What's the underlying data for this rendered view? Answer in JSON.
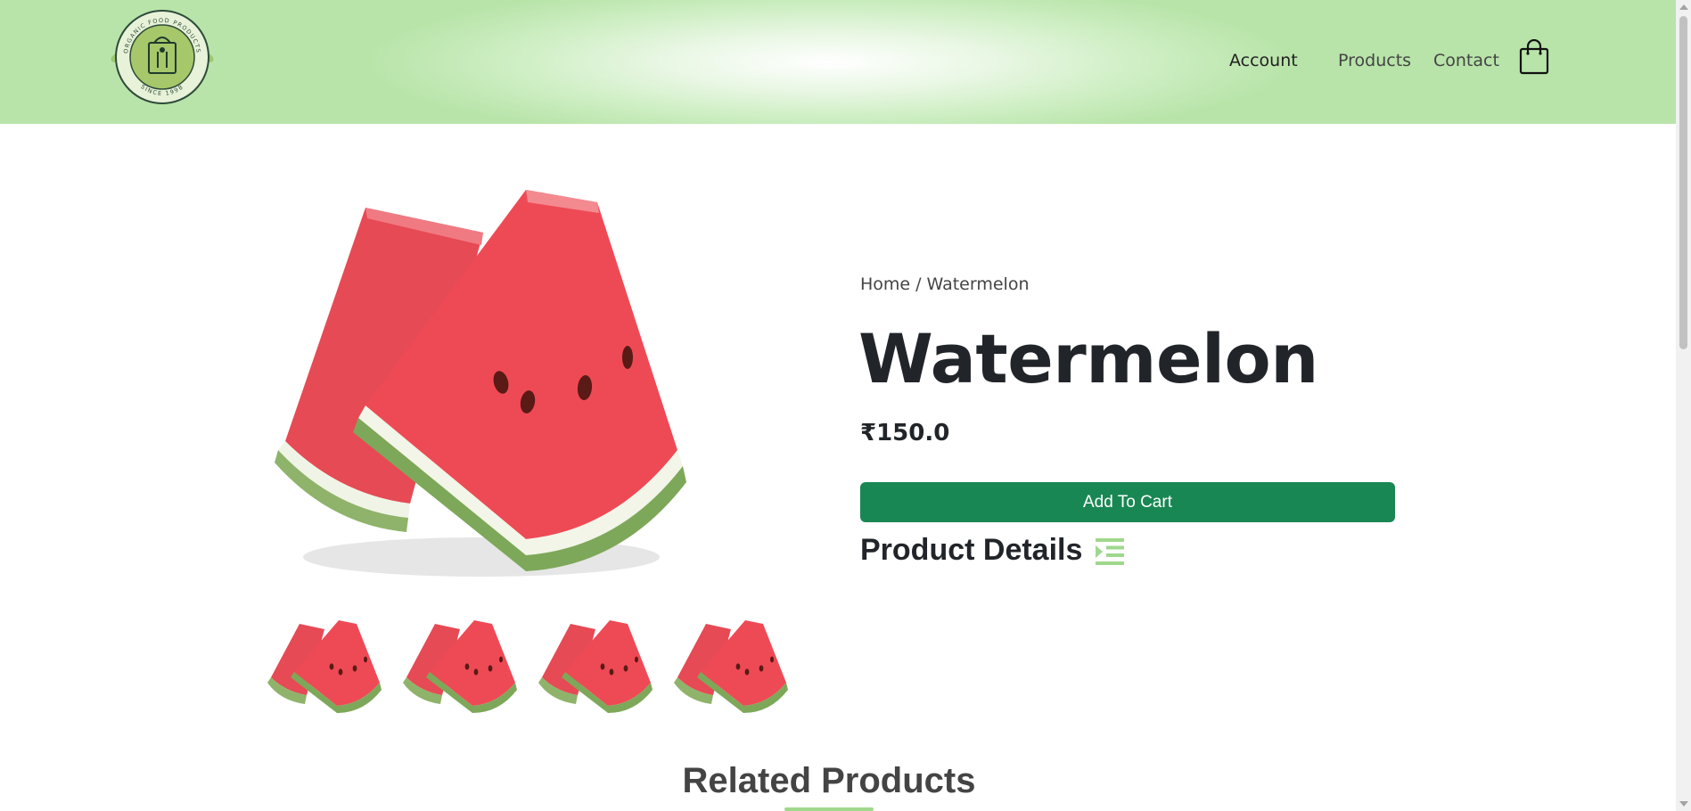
{
  "brand": {
    "logo_text_top": "ORGANIC FOOD PRODUCTS",
    "logo_text_bottom": "SINCE 1998",
    "accent": "#198754",
    "header_green": "#b8e4a9"
  },
  "nav": {
    "account": "Account",
    "products": "Products",
    "contact": "Contact",
    "cart_icon": "shopping-bag-icon"
  },
  "breadcrumb": {
    "home": "Home",
    "separator": "/",
    "current": "Watermelon"
  },
  "product": {
    "name": "Watermelon",
    "price": "₹150.0",
    "add_to_cart": "Add To Cart",
    "details_heading": "Product Details",
    "details_icon": "indent-list-icon",
    "thumbnail_count": 4
  },
  "related": {
    "heading": "Related Products"
  }
}
